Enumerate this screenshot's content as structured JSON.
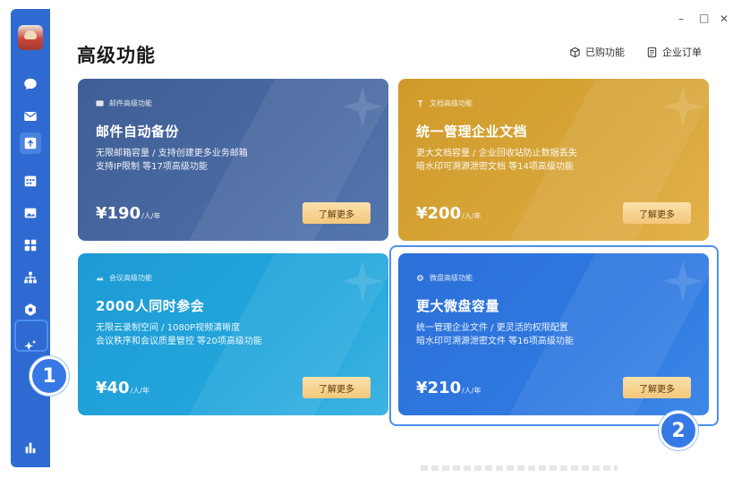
{
  "header": {
    "title": "高级功能",
    "purchased_label": "已购功能",
    "orders_label": "企业订单"
  },
  "window": {
    "minimize": "–",
    "maximize": "□",
    "close": "✕"
  },
  "sidebar": {
    "items": [
      {
        "icon": "avatar"
      },
      {
        "icon": "chat-icon"
      },
      {
        "icon": "mail-icon"
      },
      {
        "icon": "document-icon",
        "active": true
      },
      {
        "icon": "calendar-icon"
      },
      {
        "icon": "image-icon"
      },
      {
        "icon": "apps-grid-icon"
      },
      {
        "icon": "org-chart-icon"
      },
      {
        "icon": "cube-icon"
      },
      {
        "icon": "sparkle-icon",
        "highlighted": true
      },
      {
        "icon": "stats-icon"
      }
    ]
  },
  "cards": [
    {
      "tag": "邮件高级功能",
      "title": "邮件自动备份",
      "desc1": "无限邮箱容量 / 支持创建更多业务邮箱",
      "desc2": "支持IP限制 等17项高级功能",
      "price": "¥190",
      "unit": "/人/年",
      "button": "了解更多",
      "color": "#4a6aa3"
    },
    {
      "tag": "文档高级功能",
      "title": "统一管理企业文档",
      "desc1": "更大文档容量 / 企业回收站防止数据丢失",
      "desc2": "暗水印可溯源泄密文档 等14项高级功能",
      "price": "¥200",
      "unit": "/人/年",
      "button": "了解更多",
      "color": "#d8a63a"
    },
    {
      "tag": "会议高级功能",
      "title": "2000人同时参会",
      "desc1": "无限云录制空间 / 1080P视频清晰度",
      "desc2": "会议秩序和会议质量管控 等20项高级功能",
      "price": "¥40",
      "unit": "/人/年",
      "button": "了解更多",
      "color": "#23a6dc"
    },
    {
      "tag": "微盘高级功能",
      "title": "更大微盘容量",
      "desc1": "统一管理企业文件 / 更灵活的权限配置",
      "desc2": "暗水印可溯源泄密文件 等16项高级功能",
      "price": "¥210",
      "unit": "/人/年",
      "button": "了解更多",
      "color": "#2f79e0"
    }
  ],
  "badges": {
    "one": "1",
    "two": "2"
  }
}
